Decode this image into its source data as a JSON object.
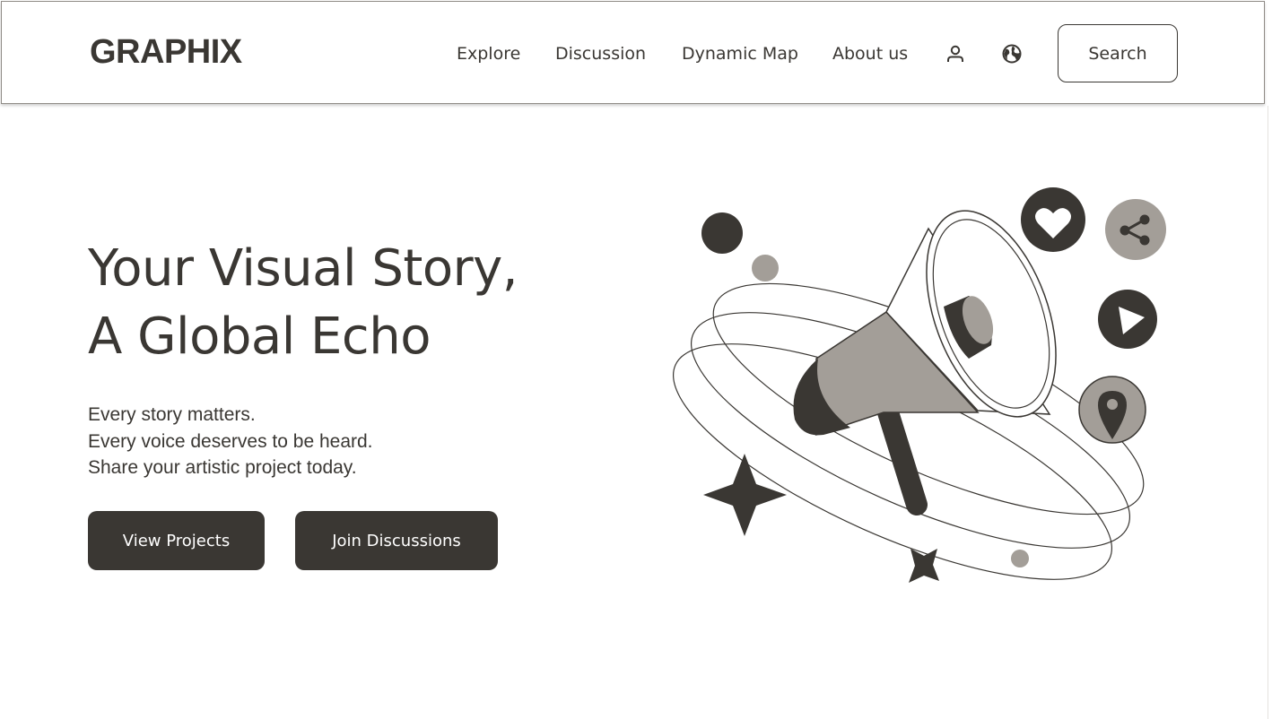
{
  "header": {
    "logo": "GRAPHIX",
    "nav": {
      "explore": "Explore",
      "discussion": "Discussion",
      "dynamic_map": "Dynamic Map",
      "about": "About us"
    },
    "icons": {
      "account": "user-icon",
      "language": "globe-icon"
    },
    "search_label": "Search"
  },
  "hero": {
    "title_line1": "Your Visual Story,",
    "title_line2": "A Global Echo",
    "subtitle": [
      "Every story matters.",
      "Every voice deserves to be heard.",
      "Share your artistic project today."
    ],
    "buttons": {
      "view_projects": "View Projects",
      "join_discussions": "Join Discussions"
    }
  },
  "illustration": {
    "subject": "megaphone-illustration",
    "icons": [
      "heart-icon",
      "share-icon",
      "play-icon",
      "location-pin-icon",
      "sparkle-star-icon"
    ]
  },
  "colors": {
    "dark": "#3a3733",
    "muted": "#a39e98",
    "background": "#ffffff",
    "border": "#8f8b86"
  }
}
